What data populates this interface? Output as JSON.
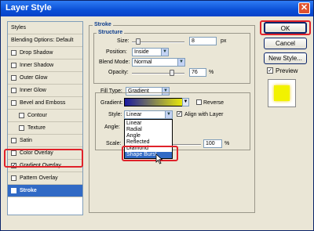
{
  "window": {
    "title": "Layer Style",
    "close_glyph": "✕"
  },
  "panel": {
    "items": [
      {
        "label": "Styles",
        "checkbox": false,
        "checked": false
      },
      {
        "label": "Blending Options: Default",
        "checkbox": false,
        "checked": false
      },
      {
        "label": "Drop Shadow",
        "checkbox": true,
        "checked": false
      },
      {
        "label": "Inner Shadow",
        "checkbox": true,
        "checked": false
      },
      {
        "label": "Outer Glow",
        "checkbox": true,
        "checked": false
      },
      {
        "label": "Inner Glow",
        "checkbox": true,
        "checked": false
      },
      {
        "label": "Bevel and Emboss",
        "checkbox": true,
        "checked": false
      },
      {
        "label": "Contour",
        "checkbox": true,
        "checked": false
      },
      {
        "label": "Texture",
        "checkbox": true,
        "checked": false
      },
      {
        "label": "Satin",
        "checkbox": true,
        "checked": false
      },
      {
        "label": "Color Overlay",
        "checkbox": true,
        "checked": false
      },
      {
        "label": "Gradient Overlay",
        "checkbox": true,
        "checked": true
      },
      {
        "label": "Pattern Overlay",
        "checkbox": true,
        "checked": false
      },
      {
        "label": "Stroke",
        "checkbox": true,
        "checked": true,
        "selected": true
      }
    ]
  },
  "stroke": {
    "group_title": "Stroke",
    "structure_title": "Structure",
    "size_label": "Size:",
    "size_value": "8",
    "size_unit": "px",
    "position_label": "Position:",
    "position_value": "Inside",
    "blend_mode_label": "Blend Mode:",
    "blend_mode_value": "Normal",
    "opacity_label": "Opacity:",
    "opacity_value": "76",
    "opacity_unit": "%",
    "fill_type_label": "Fill Type:",
    "fill_type_value": "Gradient",
    "gradient_label": "Gradient:",
    "reverse_label": "Reverse",
    "style_label": "Style:",
    "style_value": "Linear",
    "align_label": "Align with Layer",
    "angle_label": "Angle:",
    "scale_label": "Scale:",
    "scale_value": "100",
    "scale_unit": "%",
    "style_options": [
      "Linear",
      "Radial",
      "Angle",
      "Reflected",
      "Diamond",
      "Shape Burst"
    ],
    "highlighted_option": "Shape Burst"
  },
  "buttons": {
    "ok": "OK",
    "cancel": "Cancel",
    "new_style": "New Style...",
    "preview": "Preview"
  },
  "colors": {
    "gradient_start": "#1a1aa0",
    "gradient_end": "#f5f500",
    "highlight": "#e0222a",
    "selection": "#316ac5"
  }
}
